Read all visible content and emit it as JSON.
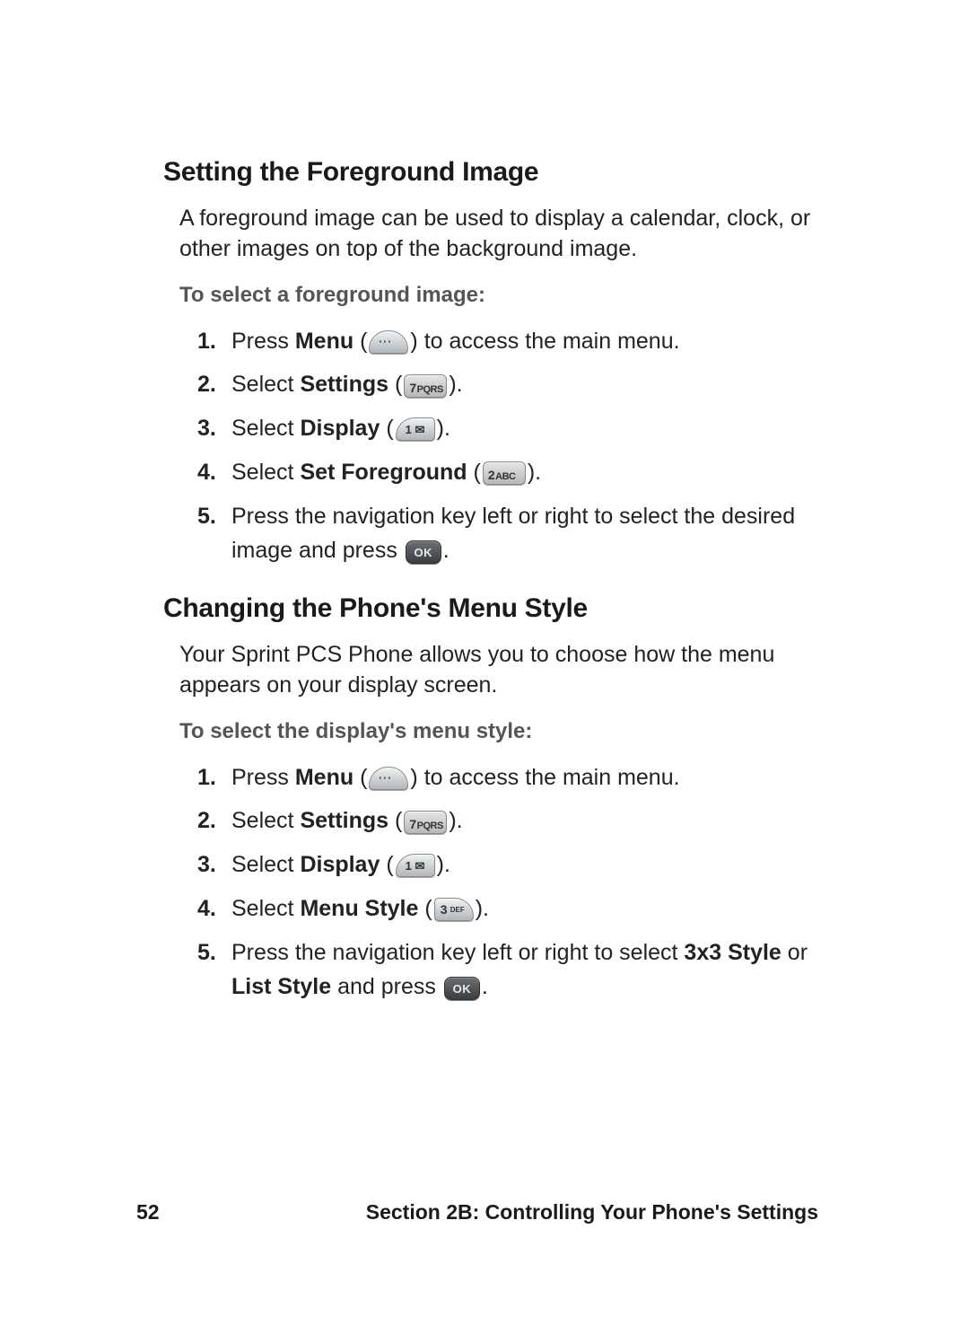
{
  "section1": {
    "title": "Setting the Foreground Image",
    "intro": "A foreground image can be used to display a calendar, clock, or other images on top of the background image.",
    "subhead": "To select a foreground image:",
    "steps": [
      {
        "num": "1.",
        "pre": "Press ",
        "bold": "Menu",
        "post_a": " (",
        "key": "menu",
        "post_b": ") to access the main menu."
      },
      {
        "num": "2.",
        "pre": "Select ",
        "bold": "Settings",
        "post_a": " (",
        "key": "7pqrs",
        "post_b": ")."
      },
      {
        "num": "3.",
        "pre": "Select ",
        "bold": "Display",
        "post_a": " (",
        "key": "1",
        "post_b": ")."
      },
      {
        "num": "4.",
        "pre": "Select ",
        "bold": "Set Foreground",
        "post_a": " (",
        "key": "2abc",
        "post_b": ")."
      },
      {
        "num": "5.",
        "pre": "Press the navigation key left or right to select the desired image and press ",
        "key": "ok",
        "post_b": "."
      }
    ]
  },
  "section2": {
    "title": "Changing the Phone's Menu Style",
    "intro": "Your Sprint PCS Phone allows you to choose how the menu appears on your display screen.",
    "subhead": "To select the display's menu style:",
    "steps": [
      {
        "num": "1.",
        "pre": "Press ",
        "bold": "Menu",
        "post_a": " (",
        "key": "menu",
        "post_b": ") to access the main menu."
      },
      {
        "num": "2.",
        "pre": "Select ",
        "bold": "Settings",
        "post_a": " (",
        "key": "7pqrs",
        "post_b": ")."
      },
      {
        "num": "3.",
        "pre": "Select ",
        "bold": "Display",
        "post_a": " (",
        "key": "1",
        "post_b": ")."
      },
      {
        "num": "4.",
        "pre": "Select ",
        "bold": "Menu Style",
        "post_a": " (",
        "key": "3def",
        "post_b": ")."
      },
      {
        "num": "5.",
        "pre": "Press the navigation key left or right to select ",
        "bold": "3x3 Style",
        "post_a": " or ",
        "bold2": "List Style",
        "post_b2": " and press ",
        "key": "ok",
        "post_b": "."
      }
    ]
  },
  "keys": {
    "7pqrs": {
      "big": "7",
      "small": "PQRS"
    },
    "2abc": {
      "big": "2",
      "small": "ABC"
    },
    "ok": "OK"
  },
  "footer": {
    "page": "52",
    "label": "Section 2B: Controlling Your Phone's Settings"
  }
}
